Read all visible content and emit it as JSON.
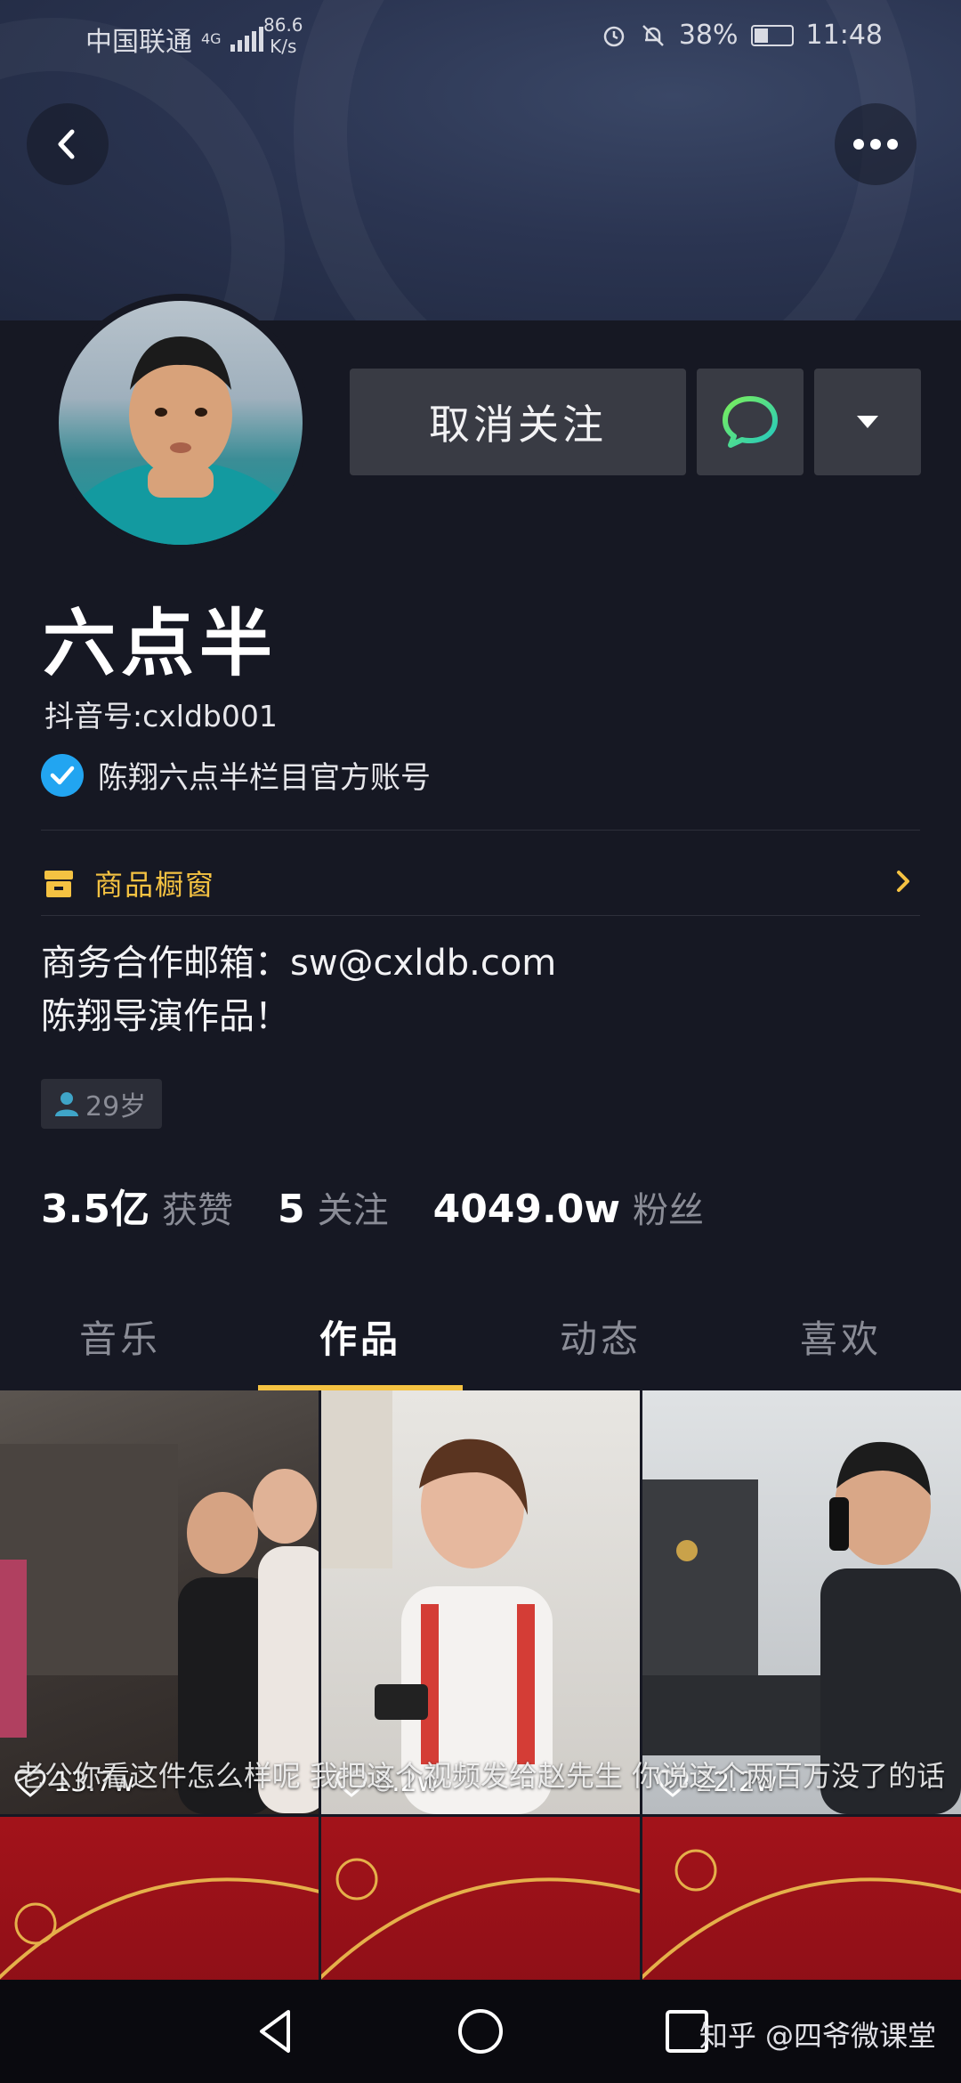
{
  "status_bar": {
    "carrier": "中国联通",
    "network": "4G",
    "speed_value": "86.6",
    "speed_unit": "K/s",
    "battery": "38%",
    "battery_level": 0.38,
    "time": "11:48"
  },
  "profile": {
    "name": "六点半",
    "douyin_id": "抖音号:cxldb001",
    "verified_text": "陈翔六点半栏目官方账号",
    "shop_label": "商品橱窗",
    "bio_line1": "商务合作邮箱：sw@cxldb.com",
    "bio_line2": "陈翔导演作品！",
    "age": "29岁"
  },
  "actions": {
    "unfollow_label": "取消关注"
  },
  "stats": {
    "likes_value": "3.5亿",
    "likes_label": "获赞",
    "following_value": "5",
    "following_label": "关注",
    "followers_value": "4049.0w",
    "followers_label": "粉丝"
  },
  "tabs": [
    {
      "label": "音乐"
    },
    {
      "label": "作品"
    },
    {
      "label": "动态"
    },
    {
      "label": "喜欢"
    }
  ],
  "active_tab_index": 1,
  "videos": [
    {
      "likes": "13.7w"
    },
    {
      "likes": "8.2w"
    },
    {
      "likes": "22.2w"
    }
  ],
  "subtitle_overlay": "老公你看这件怎么样呢  我把这个视频发给赵先生  你说这个两百万没了的话",
  "watermark": "知乎 @四爷微课堂",
  "colors": {
    "accent_yellow": "#f5c242",
    "verified_blue": "#22a5f1",
    "chat_green": "#3ddc97",
    "background": "#161823"
  }
}
